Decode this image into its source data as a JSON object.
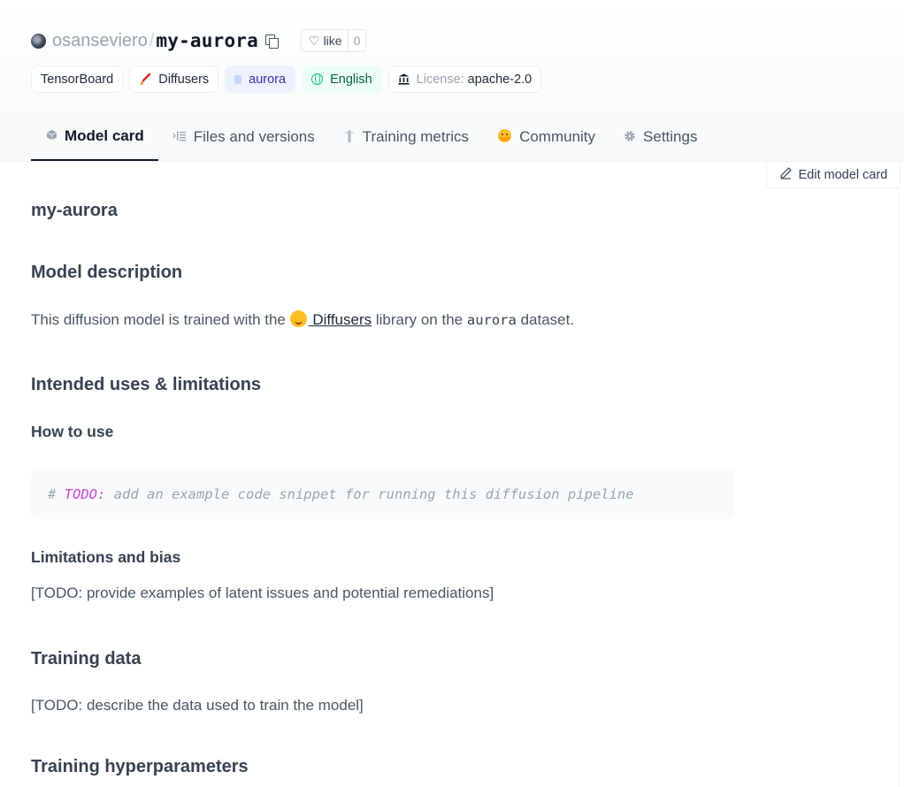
{
  "repo": {
    "owner": "osanseviero",
    "separator": "/",
    "name": "my-aurora",
    "like_label": "like",
    "like_count": "0"
  },
  "tags": [
    {
      "label": "TensorBoard",
      "icon": "none"
    },
    {
      "label": "Diffusers",
      "icon": "brush-icon"
    },
    {
      "label": "aurora",
      "icon": "dataset-icon"
    },
    {
      "label": "English",
      "icon": "globe-icon"
    },
    {
      "prefix": "License:",
      "label": "apache-2.0",
      "icon": "bank-icon"
    }
  ],
  "tabs": [
    {
      "label": "Model card",
      "icon": "cube-icon",
      "active": true
    },
    {
      "label": "Files and versions",
      "icon": "files-icon"
    },
    {
      "label": "Training metrics",
      "icon": "metrics-icon"
    },
    {
      "label": "Community",
      "icon": "community-emoji-icon"
    },
    {
      "label": "Settings",
      "icon": "gear-icon"
    }
  ],
  "edit_button": "Edit model card",
  "card": {
    "title": "my-aurora",
    "model_description_heading": "Model description",
    "description_before": "This diffusion model is trained with the",
    "description_link": " Diffusers",
    "description_mid": " library on the ",
    "description_code": "aurora",
    "description_after": " dataset.",
    "intended_heading": "Intended uses & limitations",
    "how_to_use_heading": "How to use",
    "code_prefix": "# ",
    "code_todo": "TODO:",
    "code_rest": " add an example code snippet for running this diffusion pipeline",
    "limitations_heading": "Limitations and bias",
    "limitations_text": "[TODO: provide examples of latent issues and potential remediations]",
    "training_data_heading": "Training data",
    "training_data_text": "[TODO: describe the data used to train the model]",
    "hyperparams_heading": "Training hyperparameters"
  },
  "colors": {
    "accent_dataset": "#eef2ff",
    "accent_language": "#ecfdf5",
    "text_primary": "#111827",
    "code_comment": "#9ca3af",
    "code_keyword": "#c026d3"
  }
}
